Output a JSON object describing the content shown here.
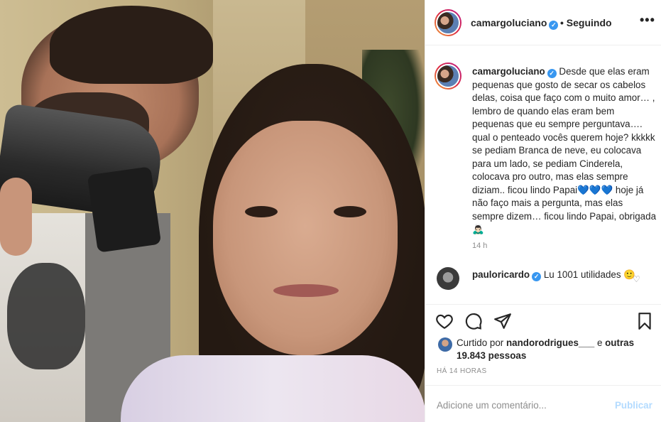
{
  "post": {
    "username": "camargoluciano",
    "verified_badge": "✓",
    "follow_status": "• Seguindo",
    "more_label": "•••"
  },
  "caption": {
    "username": "camargoluciano",
    "text_part1": " Desde que elas eram pequenas que gosto de secar os cabelos delas, coisa que faço com o muito amor… , lembro de quando elas eram bem pequenas que eu sempre perguntava…. qual o penteado vocês querem hoje? kkkkk se pediam Branca de neve, eu colocava para um lado, se pediam Cinderela, colocava pro outro, mas elas sempre diziam.. ficou lindo Papai",
    "hearts": "💙💙💙",
    "text_part2": " hoje já não faço mais a pergunta, mas elas sempre dizem… ficou lindo Papai, obrigada",
    "end_emoji": "🙇🏻‍♂️",
    "time": "14 h"
  },
  "comment": {
    "username": "pauloricardo",
    "text": " Lu 1001 utilidades",
    "emoji": "🙂"
  },
  "likes": {
    "prefix": "Curtido por ",
    "user": "nandorodrigues___",
    "middle": " e ",
    "others": "outras 19.843 pessoas"
  },
  "date": "HÁ 14 HORAS",
  "add_comment": {
    "placeholder": "Adicione um comentário...",
    "post_button": "Publicar"
  },
  "icons": {
    "like": "heart-icon",
    "comment": "comment-icon",
    "share": "share-icon",
    "save": "bookmark-icon"
  }
}
